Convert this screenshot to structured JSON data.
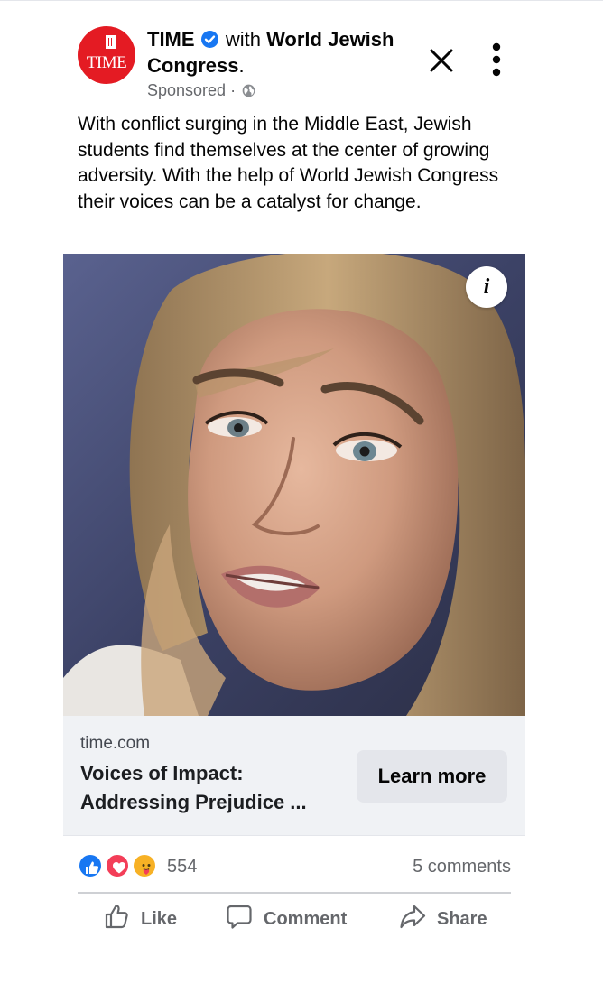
{
  "post": {
    "page_name": "TIME",
    "with_text": "with",
    "partner_name": "World Jewish Congress",
    "period": ".",
    "avatar_logo_text": "TIME",
    "sponsored_label": "Sponsored",
    "separator": "·",
    "icons": {
      "verified": "verified-badge-icon",
      "audience": "globe-icon",
      "close": "close-icon",
      "more": "more-options-icon",
      "info": "info-icon"
    },
    "message": "With conflict surging in the Middle East, Jewish students find themselves at the center of growing adversity. With the help of World Jewish Congress their voices can be a catalyst for change."
  },
  "media": {
    "info_label": "i"
  },
  "link_card": {
    "domain": "time.com",
    "headline": "Voices of Impact: Addressing Prejudice ...",
    "cta_label": "Learn more"
  },
  "stats": {
    "reaction_icons": [
      "like-reaction-icon",
      "love-reaction-icon",
      "care-reaction-icon"
    ],
    "reaction_count": "554",
    "comment_count": "5 comments"
  },
  "actions": {
    "like_label": "Like",
    "comment_label": "Comment",
    "share_label": "Share"
  },
  "colors": {
    "brand_red": "#e41b23",
    "facebook_blue": "#1877f2",
    "secondary_text": "#65676b",
    "card_bg": "#f0f2f5"
  }
}
